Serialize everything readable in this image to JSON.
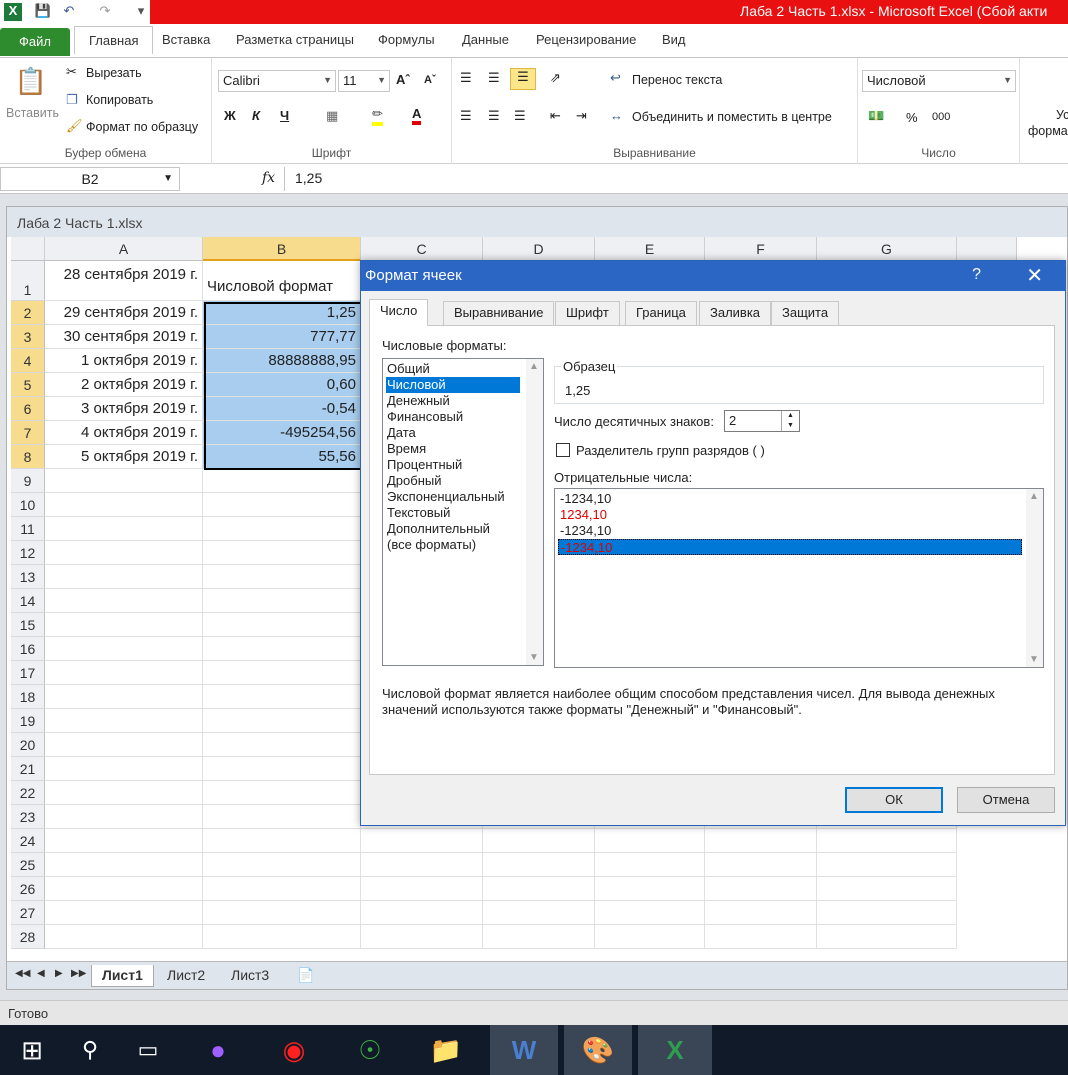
{
  "window": {
    "title": "Лаба 2 Часть 1.xlsx  -  Microsoft Excel (Сбой акти"
  },
  "ribbon_tabs": [
    "Файл",
    "Главная",
    "Вставка",
    "Разметка страницы",
    "Формулы",
    "Данные",
    "Рецензирование",
    "Вид"
  ],
  "ribbon": {
    "clipboard": {
      "paste": "Вставить",
      "cut": "Вырезать",
      "copy": "Копировать",
      "format_painter": "Формат по образцу",
      "label": "Буфер обмена"
    },
    "font": {
      "name": "Calibri",
      "size": "11",
      "bold": "Ж",
      "italic": "К",
      "underline": "Ч",
      "label": "Шрифт"
    },
    "alignment": {
      "wrap": "Перенос текста",
      "merge": "Объединить и поместить в центре",
      "label": "Выравнивание"
    },
    "number": {
      "format": "Числовой",
      "percent": "%",
      "thousands": "000",
      "label": "Число"
    },
    "styles": {
      "line1": "Ус",
      "line2": "форма"
    }
  },
  "formula_bar": {
    "cell_ref": "B2",
    "fx": "fx",
    "value": "1,25"
  },
  "workbook": {
    "title": "Лаба 2 Часть 1.xlsx",
    "columns": [
      "A",
      "B",
      "C",
      "D",
      "E",
      "F",
      "G"
    ],
    "rows": [
      "1",
      "2",
      "3",
      "4",
      "5",
      "6",
      "7",
      "8",
      "9",
      "10",
      "11",
      "12",
      "13",
      "14",
      "15",
      "16",
      "17",
      "18",
      "19",
      "20",
      "21",
      "22",
      "23",
      "24",
      "25",
      "26",
      "27",
      "28"
    ],
    "colA": [
      "28 сентября 2019 г.",
      "29 сентября 2019 г.",
      "30 сентября 2019 г.",
      "1 октября 2019 г.",
      "2 октября 2019 г.",
      "3 октября 2019 г.",
      "4 октября 2019 г.",
      "5 октября 2019 г."
    ],
    "colB": [
      "Числовой формат",
      "1,25",
      "777,77",
      "88888888,95",
      "0,60",
      "-0,54",
      "-495254,56",
      "55,56"
    ],
    "sheets": [
      "Лист1",
      "Лист2",
      "Лист3"
    ]
  },
  "status": "Готово",
  "dialog": {
    "title": "Формат ячеек",
    "help": "?",
    "close": "✕",
    "tabs": [
      "Число",
      "Выравнивание",
      "Шрифт",
      "Граница",
      "Заливка",
      "Защита"
    ],
    "categories_label": "Числовые форматы:",
    "categories": [
      "Общий",
      "Числовой",
      "Денежный",
      "Финансовый",
      "Дата",
      "Время",
      "Процентный",
      "Дробный",
      "Экспоненциальный",
      "Текстовый",
      "Дополнительный",
      "(все форматы)"
    ],
    "sample_label": "Образец",
    "sample_value": "1,25",
    "decimals_label": "Число десятичных знаков:",
    "decimals_value": "2",
    "separator_label": "Разделитель групп разрядов ( )",
    "negative_label": "Отрицательные числа:",
    "negative_options": [
      "-1234,10",
      "1234,10",
      "-1234,10",
      "-1234,10"
    ],
    "description": "Числовой формат является наиболее общим способом представления чисел. Для вывода денежных значений используются также форматы \"Денежный\" и \"Финансовый\".",
    "ok": "ОК",
    "cancel": "Отмена"
  }
}
